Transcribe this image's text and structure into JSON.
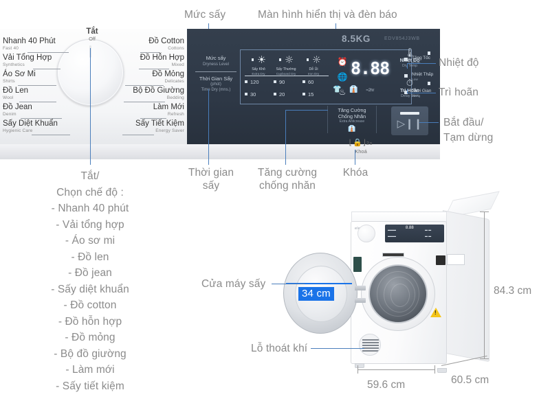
{
  "callouts": {
    "dryness_level": "Mức sấy",
    "display_and_indicators": "Màn hình hiển thị và đèn báo",
    "temperature": "Nhiệt độ",
    "delay": "Trì hoãn",
    "start_pause": "Bắt đầu/\nTạm dừng",
    "drying_time": "Thời gian\nsấy",
    "extra_anticrease": "Tăng cường\nchống nhăn",
    "lock": "Khóa",
    "mode_selector": "Tắt/\nChọn chế độ :\n- Nhanh 40 phút\n- Vải tổng hợp\n- Áo sơ mi\n- Đồ len\n- Đồ jean\n- Sấy diệt khuẩn\n- Đồ cotton\n- Đồ hỗn hợp\n- Đồ mỏng\n- Bộ đồ giường\n- Làm mới\n- Sấy tiết kiệm",
    "dryer_door": "Cửa máy sấy",
    "air_vent": "Lỗ thoát khí"
  },
  "knob": {
    "off_vn": "Tắt",
    "off_en": "Off"
  },
  "programs_left": [
    {
      "vn": "Nhanh 40 Phút",
      "en": "Fast 40"
    },
    {
      "vn": "Vải Tổng Hợp",
      "en": "Synthetics"
    },
    {
      "vn": "Áo Sơ Mi",
      "en": "Shirts"
    },
    {
      "vn": "Đồ Len",
      "en": "Wool"
    },
    {
      "vn": "Đồ Jean",
      "en": "Denim"
    },
    {
      "vn": "Sấy Diệt Khuẩn",
      "en": "Hygienic Care"
    }
  ],
  "programs_right": [
    {
      "vn": "Đồ Cotton",
      "en": "Cottons"
    },
    {
      "vn": "Đồ Hỗn Hợp",
      "en": "Mixed"
    },
    {
      "vn": "Đồ Mỏng",
      "en": "Delicates"
    },
    {
      "vn": "Bộ Đồ Giường",
      "en": "Bedding"
    },
    {
      "vn": "Làm Mới",
      "en": "Refresh"
    },
    {
      "vn": "Sấy Tiết Kiệm",
      "en": "Energy Saver"
    }
  ],
  "panel": {
    "capacity": "8.5KG",
    "model": "EDV854J3WB",
    "dryness_vn": "Mức sấy",
    "dryness_en": "Dryness Level",
    "time_vn": "Thời Gian Sấy",
    "time_unit_vn": "(phút)",
    "time_en": "Time Dry (mns.)",
    "segment_display": "8.88"
  },
  "dryness_options": [
    {
      "vn": "Sấy Khô",
      "en": "Extra Dry"
    },
    {
      "vn": "Sấy Thường",
      "en": "Cupboard Dry"
    },
    {
      "vn": "Dễ Ủi",
      "en": "Iron Dry"
    }
  ],
  "time_options": [
    "120",
    "90",
    "60",
    "30",
    "20",
    "15"
  ],
  "status_indicators": [
    {
      "vn": "Tăng Tốc",
      "en": "Boost"
    },
    {
      "vn": "Nhiệt Thấp",
      "en": "Low"
    },
    {
      "vn": "Thời Gian",
      "en": "Airing"
    }
  ],
  "anticrease_button": {
    "vn_line1": "Tăng Cường",
    "vn_line2": "Chống Nhăn",
    "en": "Extra Anticrease"
  },
  "side_buttons": [
    {
      "vn": "Nhiệt Độ",
      "en": "Dry Temp"
    },
    {
      "vn": "Trì Hoãn",
      "en": "Delay Start"
    }
  ],
  "lock_button": {
    "glyph": "2s",
    "vn": "Khoá"
  },
  "dimensions": {
    "height": "84.3 cm",
    "width": "59.6 cm",
    "depth": "60.5 cm",
    "door_opening": "34 cm"
  },
  "colors": {
    "accent_blue": "#1a73e8",
    "leader_blue": "#4a7ebb",
    "panel_dark": "#2e3846",
    "text_gray": "#8b8b8b"
  }
}
